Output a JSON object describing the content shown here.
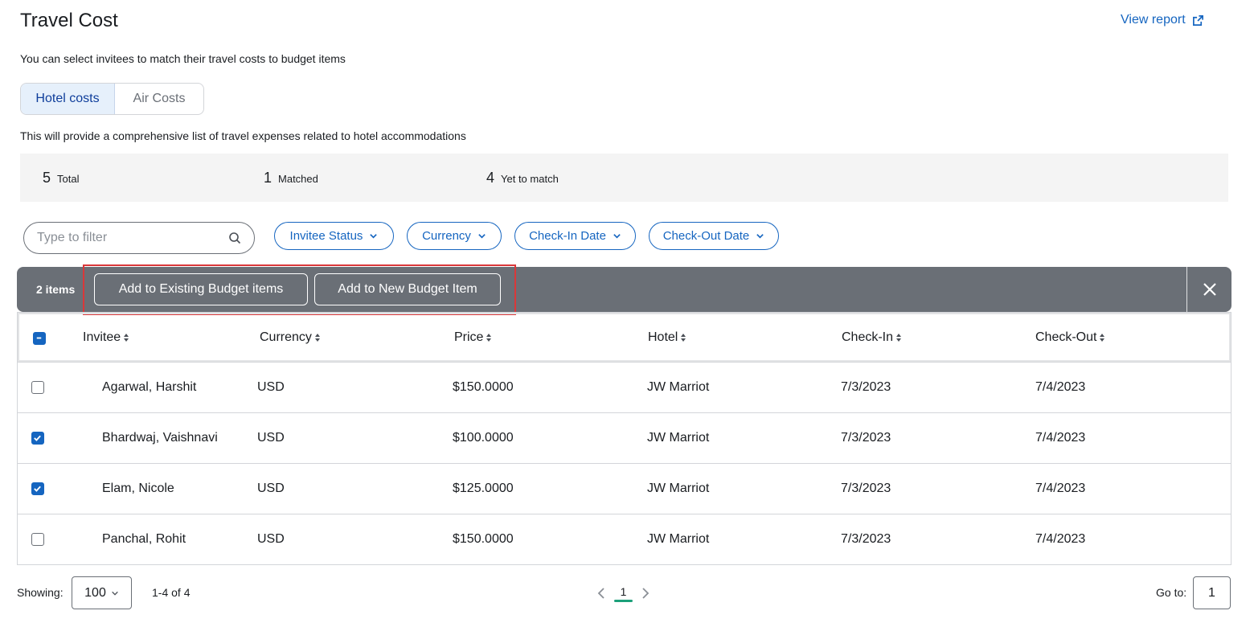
{
  "header": {
    "title": "Travel Cost",
    "view_report_label": "View report",
    "view_report_icon": "external-link-icon",
    "subtitle": "You can select invitees to match their travel costs to budget items"
  },
  "tabs": [
    {
      "label": "Hotel costs",
      "active": true
    },
    {
      "label": "Air Costs",
      "active": false
    }
  ],
  "description": "This will provide a comprehensive list of travel expenses related to hotel accommodations",
  "stats": [
    {
      "value": "5",
      "label": "Total"
    },
    {
      "value": "1",
      "label": "Matched"
    },
    {
      "value": "4",
      "label": "Yet to match"
    }
  ],
  "filter": {
    "placeholder": "Type to filter",
    "icon": "search-icon"
  },
  "filter_pills": [
    {
      "label": "Invitee Status"
    },
    {
      "label": "Currency"
    },
    {
      "label": "Check-In Date"
    },
    {
      "label": "Check-Out Date"
    }
  ],
  "action_bar": {
    "count_label": "2 items",
    "add_existing_label": "Add to Existing Budget items",
    "add_new_label": "Add to New Budget Item",
    "close_icon": "close-icon",
    "background_color": "#6a6f76",
    "highlight_color": "#d9383a"
  },
  "table": {
    "columns": [
      "Invitee",
      "Currency",
      "Price",
      "Hotel",
      "Check-In",
      "Check-Out"
    ],
    "header_checkbox": "indeterminate",
    "rows": [
      {
        "checked": false,
        "invitee": "Agarwal, Harshit",
        "currency": "USD",
        "price": "$150.0000",
        "hotel": "JW Marriot",
        "check_in": "7/3/2023",
        "check_out": "7/4/2023"
      },
      {
        "checked": true,
        "invitee": "Bhardwaj, Vaishnavi",
        "currency": "USD",
        "price": "$100.0000",
        "hotel": "JW Marriot",
        "check_in": "7/3/2023",
        "check_out": "7/4/2023"
      },
      {
        "checked": true,
        "invitee": "Elam, Nicole",
        "currency": "USD",
        "price": "$125.0000",
        "hotel": "JW Marriot",
        "check_in": "7/3/2023",
        "check_out": "7/4/2023"
      },
      {
        "checked": false,
        "invitee": "Panchal, Rohit",
        "currency": "USD",
        "price": "$150.0000",
        "hotel": "JW Marriot",
        "check_in": "7/3/2023",
        "check_out": "7/4/2023"
      }
    ]
  },
  "footer": {
    "showing_label": "Showing:",
    "page_size": "100",
    "range": "1-4 of 4",
    "current_page": "1",
    "goto_label": "Go to:",
    "goto_value": "1",
    "accent_color": "#1ca07a"
  },
  "colors": {
    "primary": "#1565c0",
    "text": "#1a1d21"
  }
}
